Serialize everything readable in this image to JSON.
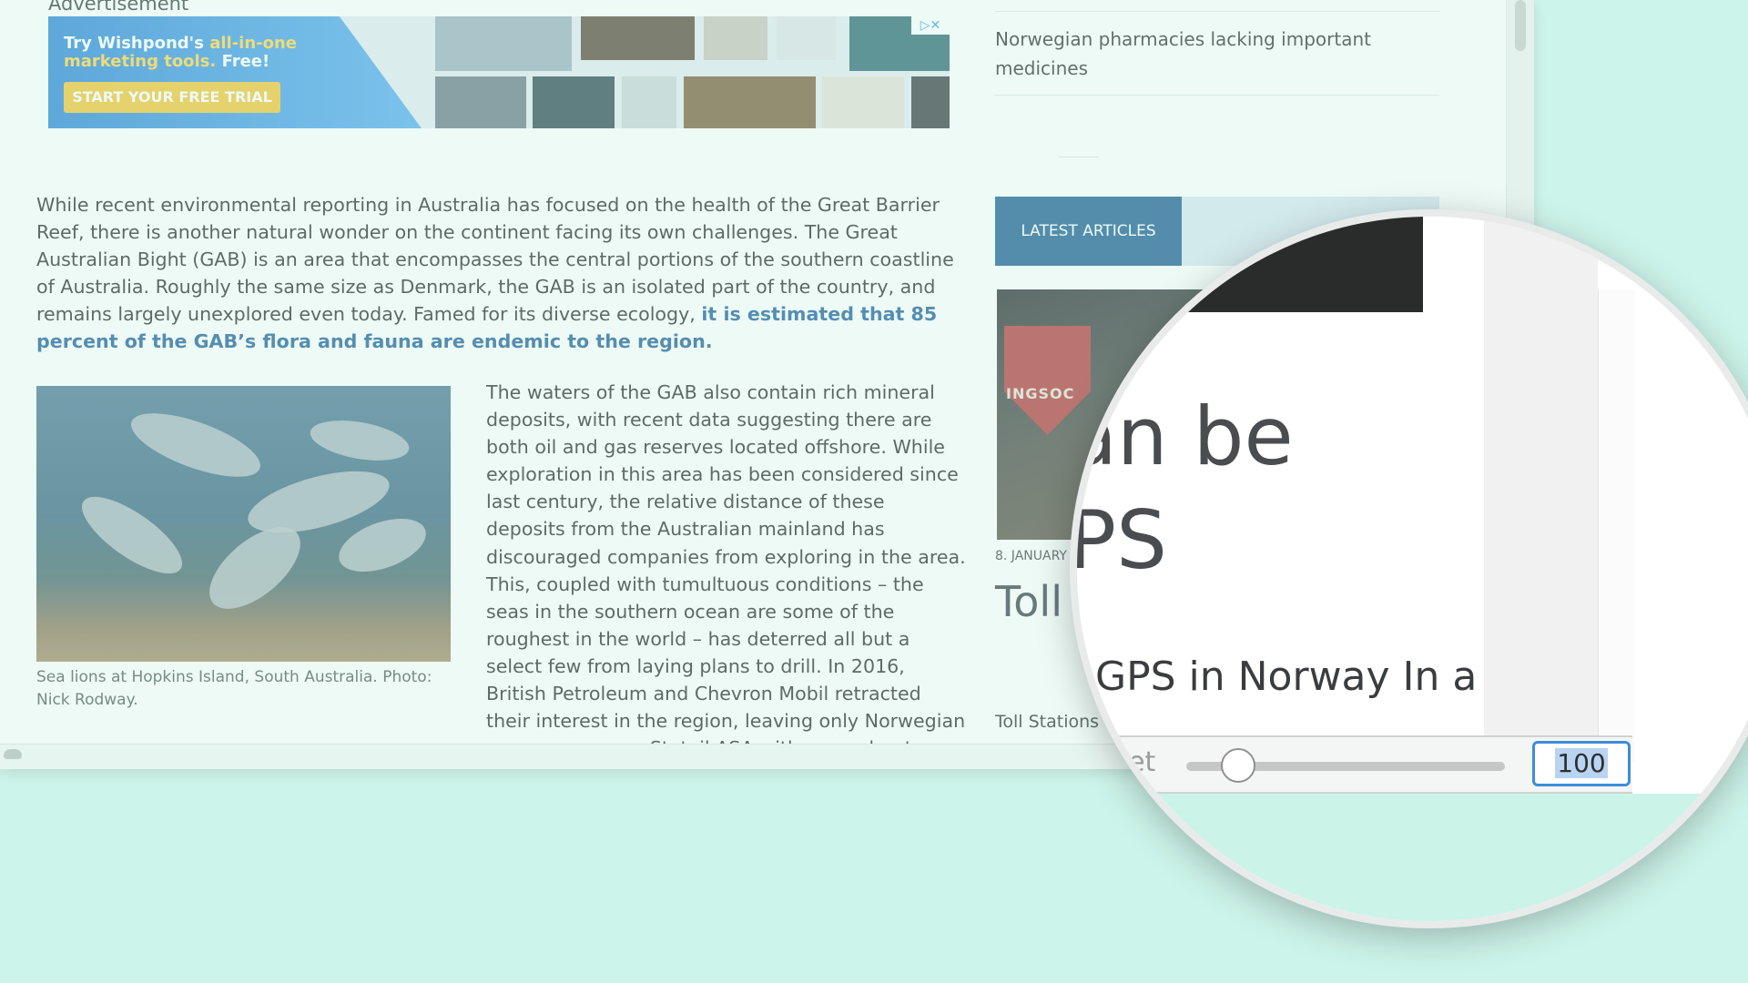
{
  "ad": {
    "label": "Advertisement",
    "headline_prefix": "Try Wishpond's",
    "headline_highlight": "all-in-one",
    "headline_rest": "marketing tools.",
    "headline_free": "Free!",
    "cta": "START YOUR FREE TRIAL",
    "badge": "▷✕"
  },
  "article": {
    "paragraph1": "While recent environmental reporting in Australia has focused on the health of the Great Barrier Reef, there is another natural wonder on the continent facing its own challenges. The Great Australian Bight (GAB) is an area that encompasses the central portions of the southern coastline of Australia. Roughly the same size as Denmark, the GAB is an isolated part of the country, and remains largely unexplored even today. Famed for its diverse ecology,",
    "paragraph1_link": "it is estimated that 85 percent of the GAB’s flora and fauna are endemic to the region.",
    "photo_caption": "Sea lions at Hopkins Island, South Australia. Photo: Nick Rodway.",
    "paragraph2": "The waters of the GAB also contain rich mineral deposits, with recent data suggesting there are both oil and gas reserves located offshore. While exploration in this area has been considered since last century, the relative distance of these deposits from the Australian mainland has discouraged companies from exploring in the area. This, coupled with tumultuous conditions – the seas in the southern ocean are some of the roughest in the world – has deterred all but a select few from laying plans to drill. In 2016, British Petroleum and Chevron Mobil retracted their interest in the region, leaving only Norwegian energy company Statoil ASA with an exploratory drilling licence."
  },
  "sidebar": {
    "headline": "Norwegian pharmacies lacking important medicines",
    "latest_tab": "LATEST ARTICLES",
    "image_sign": "INGSOC",
    "date": "8. JANUARY",
    "title": "Toll repla",
    "excerpt": "Toll Stations c"
  },
  "magnifier": {
    "title_line1": "an be",
    "title_line2": "PS",
    "subtitle": "GPS in Norway In a",
    "reset_label": "eset",
    "zoom_value": "100",
    "zoom_level": 100
  }
}
